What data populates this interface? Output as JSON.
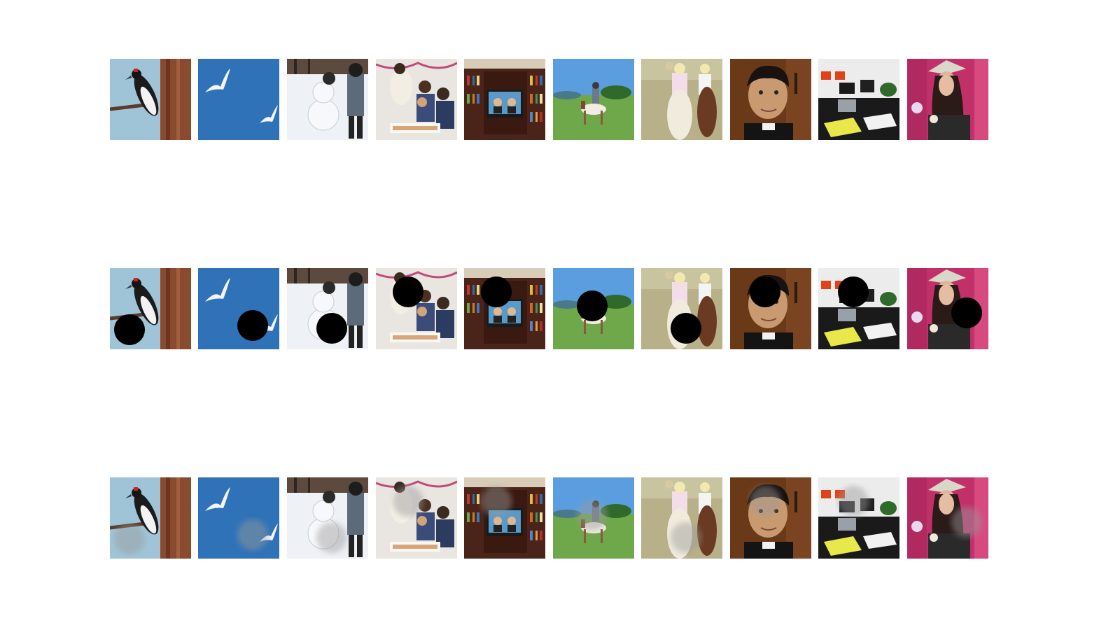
{
  "rows": [
    {
      "name": "original",
      "masked": false,
      "inpainted": false
    },
    {
      "name": "masked",
      "masked": true,
      "inpainted": false
    },
    {
      "name": "inpainted",
      "masked": false,
      "inpainted": true
    }
  ],
  "thumbnails": [
    {
      "subject": "woodpecker-on-tree",
      "mask": "bottom-left"
    },
    {
      "subject": "gulls-in-blue-sky",
      "mask": "bottom-right"
    },
    {
      "subject": "snowman-and-boy",
      "mask": "bottom-center"
    },
    {
      "subject": "family-cake-party",
      "mask": "top-left"
    },
    {
      "subject": "tv-in-bookshelf",
      "mask": "top-left"
    },
    {
      "subject": "rider-horse-meadow",
      "mask": "center"
    },
    {
      "subject": "trail-ride-horses",
      "mask": "bottom-center"
    },
    {
      "subject": "boy-portrait",
      "mask": "top-center"
    },
    {
      "subject": "office-desk",
      "mask": "top-center"
    },
    {
      "subject": "woman-with-hat",
      "mask": "right"
    }
  ],
  "colors": {
    "mask": "#000000",
    "background": "#ffffff"
  }
}
